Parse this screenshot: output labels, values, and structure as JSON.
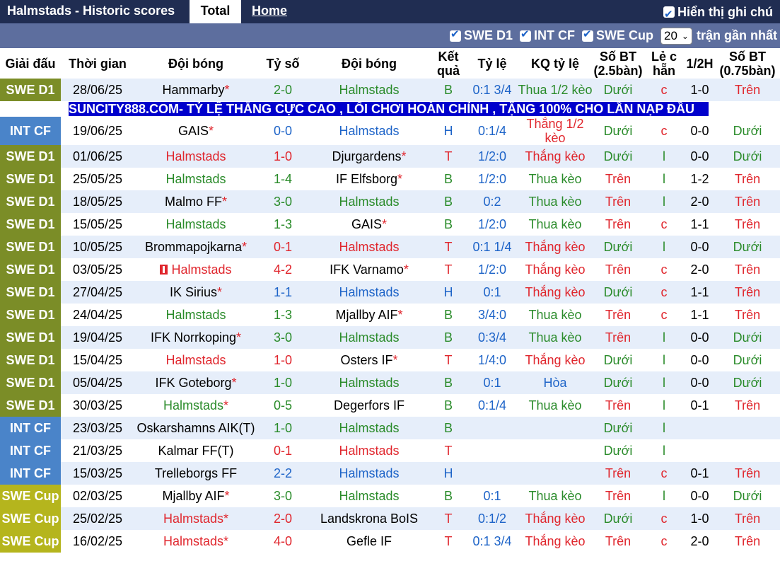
{
  "top": {
    "title": "Halmstads - Historic scores",
    "tab_total": "Total",
    "tab_home": "Home",
    "show_label": "Hiển thị ghi chú"
  },
  "filters": {
    "items": [
      "SWE D1",
      "INT CF",
      "SWE Cup"
    ],
    "count": "20",
    "suffix": "trận gần nhất"
  },
  "headers": {
    "league": "Giải đấu",
    "time": "Thời gian",
    "home": "Đội bóng",
    "score": "Tỷ số",
    "away": "Đội bóng",
    "result": "Kết quả",
    "odds": "Tỷ lệ",
    "odds_result": "KQ tỷ lệ",
    "goals25": "Số BT (2.5bàn)",
    "oddeven": "Lẻ c hẵn",
    "half": "1/2H",
    "goals075": "Số BT (0.75bàn)"
  },
  "ad": "SUNCITY888.COM- TỶ LỆ THẮNG CỰC CAO , LỐI CHƠI HOÀN CHỈNH , TẶNG 100% CHO LẦN NẠP ĐẦU",
  "colors": {
    "swe_d1": "#7b8d27",
    "int_cf": "#4a84c9",
    "swe_cup": "#b5b51d",
    "win": "#e0262d",
    "draw": "#1e64c8",
    "loss": "#2a8b2a",
    "header_bar": "#202d52",
    "filter_bar": "#5d6e9e"
  },
  "matches": [
    {
      "league": "SWE D1",
      "date": "28/06/25",
      "home": "Hammarby",
      "home_star": true,
      "home_color": "black",
      "score_h": "2",
      "score_a": "0",
      "away": "Halmstads",
      "away_star": false,
      "away_color": "green",
      "result": "B",
      "odds": "0:1 3/4",
      "odds_result": "Thua 1/2 kèo",
      "odds_color": "green",
      "goals": "Dưới",
      "goals_color": "green",
      "oe": "c",
      "half": "1-0",
      "g075": "Trên",
      "g075_color": "red"
    },
    {
      "league": "INT CF",
      "date": "19/06/25",
      "home": "GAIS",
      "home_star": true,
      "home_color": "black",
      "score_h": "0",
      "score_a": "0",
      "away": "Halmstads",
      "away_star": false,
      "away_color": "blue",
      "result": "H",
      "odds": "0:1/4",
      "odds_result": "Thắng 1/2 kèo",
      "odds_color": "red",
      "goals": "Dưới",
      "goals_color": "green",
      "oe": "c",
      "half": "0-0",
      "g075": "Dưới",
      "g075_color": "green"
    },
    {
      "league": "SWE D1",
      "date": "01/06/25",
      "home": "Halmstads",
      "home_star": false,
      "home_color": "red",
      "score_h": "1",
      "score_a": "0",
      "away": "Djurgardens",
      "away_star": true,
      "away_color": "black",
      "result": "T",
      "odds": "1/2:0",
      "odds_result": "Thắng kèo",
      "odds_color": "red",
      "goals": "Dưới",
      "goals_color": "green",
      "oe": "l",
      "half": "0-0",
      "g075": "Dưới",
      "g075_color": "green"
    },
    {
      "league": "SWE D1",
      "date": "25/05/25",
      "home": "Halmstads",
      "home_star": false,
      "home_color": "green",
      "score_h": "1",
      "score_a": "4",
      "away": "IF Elfsborg",
      "away_star": true,
      "away_color": "black",
      "result": "B",
      "odds": "1/2:0",
      "odds_result": "Thua kèo",
      "odds_color": "green",
      "goals": "Trên",
      "goals_color": "red",
      "oe": "l",
      "half": "1-2",
      "g075": "Trên",
      "g075_color": "red"
    },
    {
      "league": "SWE D1",
      "date": "18/05/25",
      "home": "Malmo FF",
      "home_star": true,
      "home_color": "black",
      "score_h": "3",
      "score_a": "0",
      "away": "Halmstads",
      "away_star": false,
      "away_color": "green",
      "result": "B",
      "odds": "0:2",
      "odds_result": "Thua kèo",
      "odds_color": "green",
      "goals": "Trên",
      "goals_color": "red",
      "oe": "l",
      "half": "2-0",
      "g075": "Trên",
      "g075_color": "red"
    },
    {
      "league": "SWE D1",
      "date": "15/05/25",
      "home": "Halmstads",
      "home_star": false,
      "home_color": "green",
      "score_h": "1",
      "score_a": "3",
      "away": "GAIS",
      "away_star": true,
      "away_color": "black",
      "result": "B",
      "odds": "1/2:0",
      "odds_result": "Thua kèo",
      "odds_color": "green",
      "goals": "Trên",
      "goals_color": "red",
      "oe": "c",
      "half": "1-1",
      "g075": "Trên",
      "g075_color": "red"
    },
    {
      "league": "SWE D1",
      "date": "10/05/25",
      "home": "Brommapojkarna",
      "home_star": true,
      "home_color": "black",
      "score_h": "0",
      "score_a": "1",
      "away": "Halmstads",
      "away_star": false,
      "away_color": "red",
      "result": "T",
      "odds": "0:1 1/4",
      "odds_result": "Thắng kèo",
      "odds_color": "red",
      "goals": "Dưới",
      "goals_color": "green",
      "oe": "l",
      "half": "0-0",
      "g075": "Dưới",
      "g075_color": "green"
    },
    {
      "league": "SWE D1",
      "date": "03/05/25",
      "home": "Halmstads",
      "home_star": false,
      "home_color": "red",
      "home_flag": true,
      "score_h": "4",
      "score_a": "2",
      "away": "IFK Varnamo",
      "away_star": true,
      "away_color": "black",
      "result": "T",
      "odds": "1/2:0",
      "odds_result": "Thắng kèo",
      "odds_color": "red",
      "goals": "Trên",
      "goals_color": "red",
      "oe": "c",
      "half": "2-0",
      "g075": "Trên",
      "g075_color": "red"
    },
    {
      "league": "SWE D1",
      "date": "27/04/25",
      "home": "IK Sirius",
      "home_star": true,
      "home_color": "black",
      "score_h": "1",
      "score_a": "1",
      "away": "Halmstads",
      "away_star": false,
      "away_color": "blue",
      "result": "H",
      "odds": "0:1",
      "odds_result": "Thắng kèo",
      "odds_color": "red",
      "goals": "Dưới",
      "goals_color": "green",
      "oe": "c",
      "half": "1-1",
      "g075": "Trên",
      "g075_color": "red"
    },
    {
      "league": "SWE D1",
      "date": "24/04/25",
      "home": "Halmstads",
      "home_star": false,
      "home_color": "green",
      "score_h": "1",
      "score_a": "3",
      "away": "Mjallby AIF",
      "away_star": true,
      "away_color": "black",
      "result": "B",
      "odds": "3/4:0",
      "odds_result": "Thua kèo",
      "odds_color": "green",
      "goals": "Trên",
      "goals_color": "red",
      "oe": "c",
      "half": "1-1",
      "g075": "Trên",
      "g075_color": "red"
    },
    {
      "league": "SWE D1",
      "date": "19/04/25",
      "home": "IFK Norrkoping",
      "home_star": true,
      "home_color": "black",
      "score_h": "3",
      "score_a": "0",
      "away": "Halmstads",
      "away_star": false,
      "away_color": "green",
      "result": "B",
      "odds": "0:3/4",
      "odds_result": "Thua kèo",
      "odds_color": "green",
      "goals": "Trên",
      "goals_color": "red",
      "oe": "l",
      "half": "0-0",
      "g075": "Dưới",
      "g075_color": "green"
    },
    {
      "league": "SWE D1",
      "date": "15/04/25",
      "home": "Halmstads",
      "home_star": false,
      "home_color": "red",
      "score_h": "1",
      "score_a": "0",
      "away": "Osters IF",
      "away_star": true,
      "away_color": "black",
      "result": "T",
      "odds": "1/4:0",
      "odds_result": "Thắng kèo",
      "odds_color": "red",
      "goals": "Dưới",
      "goals_color": "green",
      "oe": "l",
      "half": "0-0",
      "g075": "Dưới",
      "g075_color": "green"
    },
    {
      "league": "SWE D1",
      "date": "05/04/25",
      "home": "IFK Goteborg",
      "home_star": true,
      "home_color": "black",
      "score_h": "1",
      "score_a": "0",
      "away": "Halmstads",
      "away_star": false,
      "away_color": "green",
      "result": "B",
      "odds": "0:1",
      "odds_result": "Hòa",
      "odds_color": "blue",
      "goals": "Dưới",
      "goals_color": "green",
      "oe": "l",
      "half": "0-0",
      "g075": "Dưới",
      "g075_color": "green"
    },
    {
      "league": "SWE D1",
      "date": "30/03/25",
      "home": "Halmstads",
      "home_star": true,
      "home_color": "green",
      "score_h": "0",
      "score_a": "5",
      "away": "Degerfors IF",
      "away_star": false,
      "away_color": "black",
      "result": "B",
      "odds": "0:1/4",
      "odds_result": "Thua kèo",
      "odds_color": "green",
      "goals": "Trên",
      "goals_color": "red",
      "oe": "l",
      "half": "0-1",
      "g075": "Trên",
      "g075_color": "red"
    },
    {
      "league": "INT CF",
      "date": "23/03/25",
      "home": "Oskarshamns AIK(T)",
      "home_star": false,
      "home_color": "black",
      "score_h": "1",
      "score_a": "0",
      "away": "Halmstads",
      "away_star": false,
      "away_color": "green",
      "result": "B",
      "odds": "",
      "odds_result": "",
      "odds_color": "green",
      "goals": "Dưới",
      "goals_color": "green",
      "oe": "l",
      "half": "",
      "g075": "",
      "g075_color": "red"
    },
    {
      "league": "INT CF",
      "date": "21/03/25",
      "home": "Kalmar FF(T)",
      "home_star": false,
      "home_color": "black",
      "score_h": "0",
      "score_a": "1",
      "away": "Halmstads",
      "away_star": false,
      "away_color": "red",
      "result": "T",
      "odds": "",
      "odds_result": "",
      "odds_color": "green",
      "goals": "Dưới",
      "goals_color": "green",
      "oe": "l",
      "half": "",
      "g075": "",
      "g075_color": "red"
    },
    {
      "league": "INT CF",
      "date": "15/03/25",
      "home": "Trelleborgs FF",
      "home_star": false,
      "home_color": "black",
      "score_h": "2",
      "score_a": "2",
      "away": "Halmstads",
      "away_star": false,
      "away_color": "blue",
      "result": "H",
      "odds": "",
      "odds_result": "",
      "odds_color": "green",
      "goals": "Trên",
      "goals_color": "red",
      "oe": "c",
      "half": "0-1",
      "g075": "Trên",
      "g075_color": "red"
    },
    {
      "league": "SWE Cup",
      "date": "02/03/25",
      "home": "Mjallby AIF",
      "home_star": true,
      "home_color": "black",
      "score_h": "3",
      "score_a": "0",
      "away": "Halmstads",
      "away_star": false,
      "away_color": "green",
      "result": "B",
      "odds": "0:1",
      "odds_result": "Thua kèo",
      "odds_color": "green",
      "goals": "Trên",
      "goals_color": "red",
      "oe": "l",
      "half": "0-0",
      "g075": "Dưới",
      "g075_color": "green"
    },
    {
      "league": "SWE Cup",
      "date": "25/02/25",
      "home": "Halmstads",
      "home_star": true,
      "home_color": "red",
      "score_h": "2",
      "score_a": "0",
      "away": "Landskrona BoIS",
      "away_star": false,
      "away_color": "black",
      "result": "T",
      "odds": "0:1/2",
      "odds_result": "Thắng kèo",
      "odds_color": "red",
      "goals": "Dưới",
      "goals_color": "green",
      "oe": "c",
      "half": "1-0",
      "g075": "Trên",
      "g075_color": "red"
    },
    {
      "league": "SWE Cup",
      "date": "16/02/25",
      "home": "Halmstads",
      "home_star": true,
      "home_color": "red",
      "score_h": "4",
      "score_a": "0",
      "away": "Gefle IF",
      "away_star": false,
      "away_color": "black",
      "result": "T",
      "odds": "0:1 3/4",
      "odds_result": "Thắng kèo",
      "odds_color": "red",
      "goals": "Trên",
      "goals_color": "red",
      "oe": "c",
      "half": "2-0",
      "g075": "Trên",
      "g075_color": "red"
    }
  ]
}
